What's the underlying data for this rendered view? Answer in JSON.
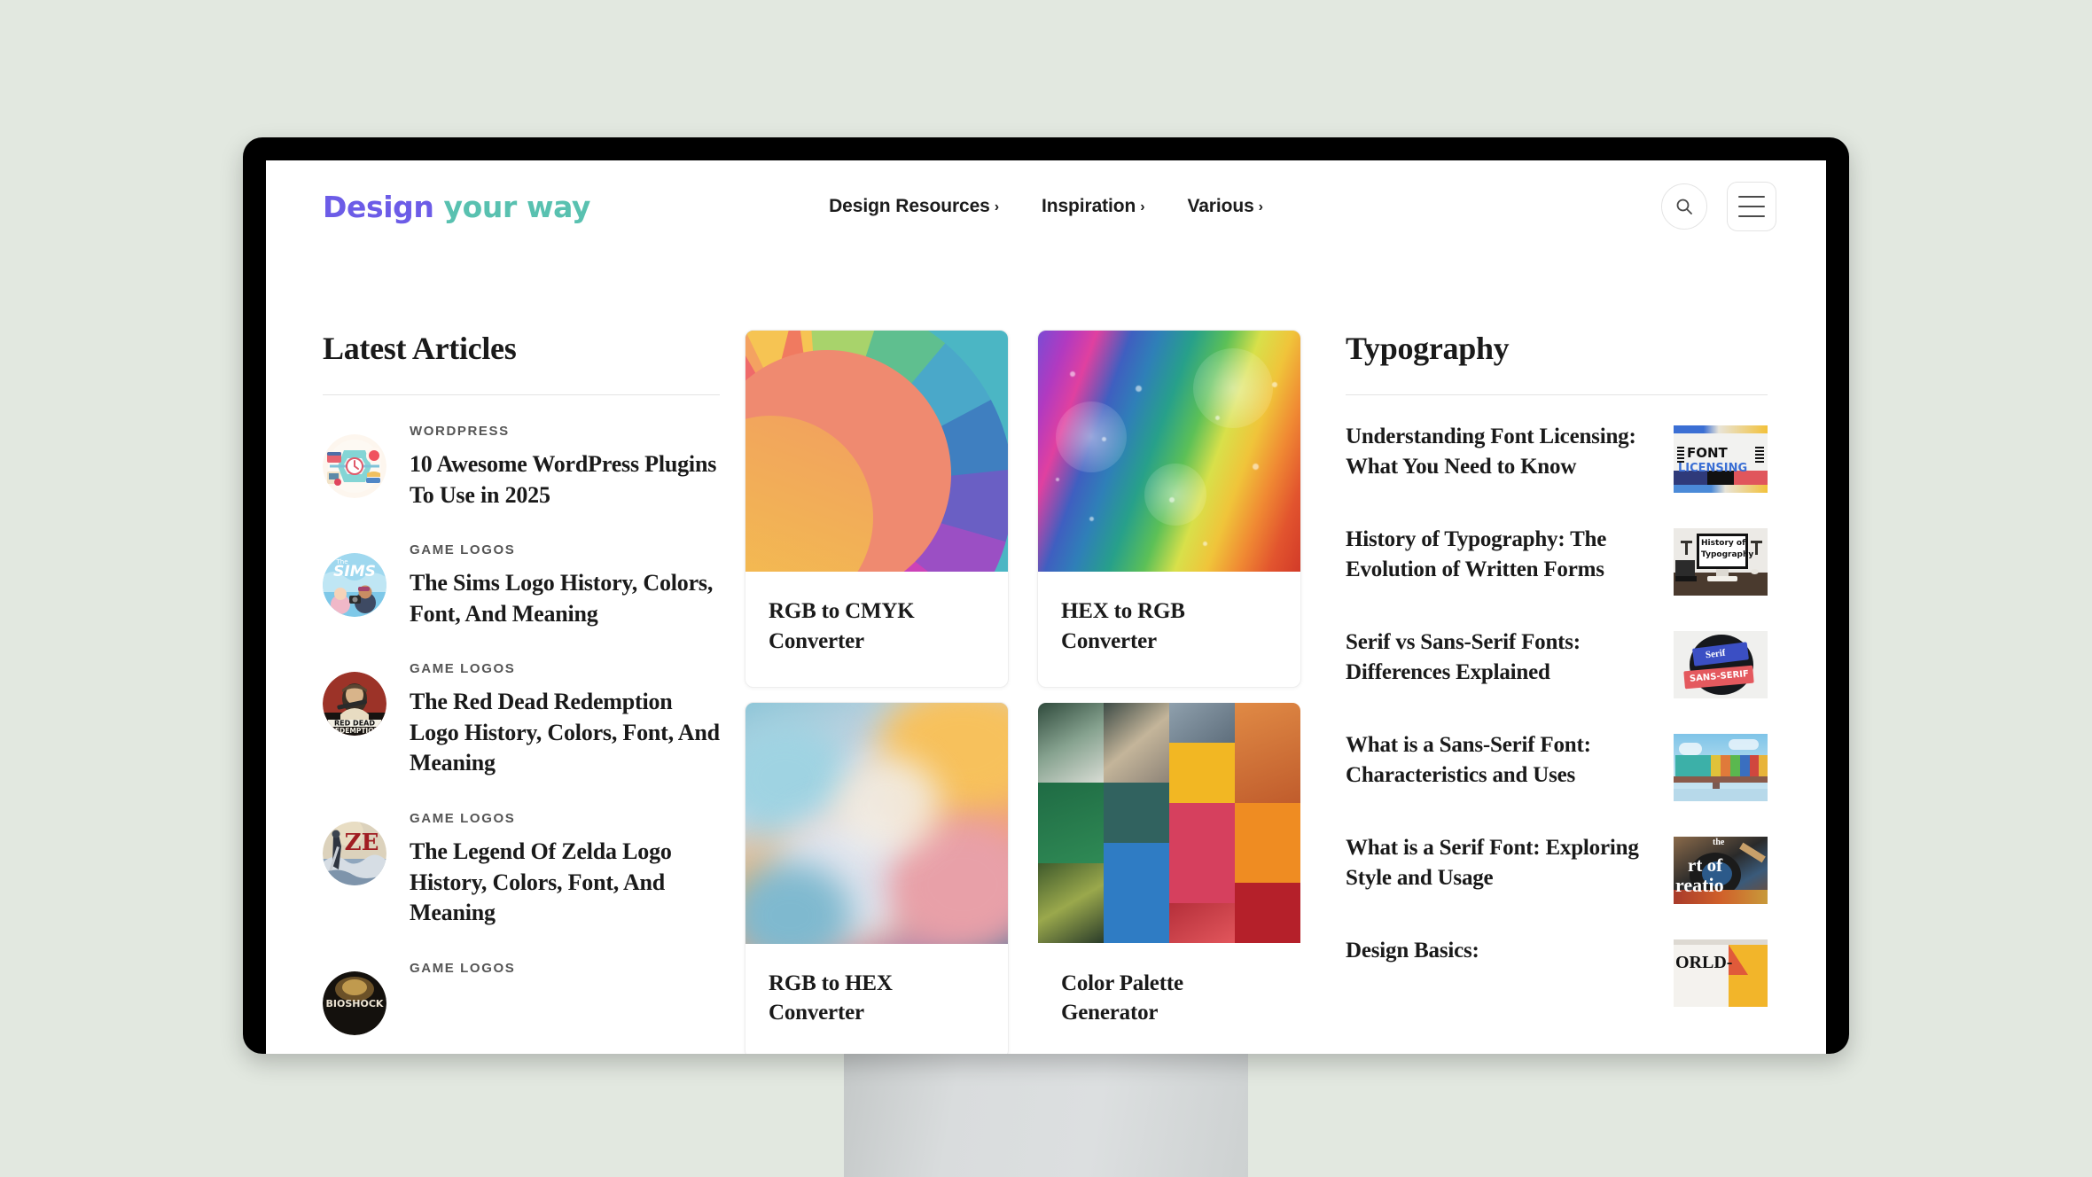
{
  "page": {
    "background_color": "#e2e8e0",
    "device": "desktop-monitor-mockup"
  },
  "header": {
    "logo": {
      "part_one": "Design",
      "part_two": "your way",
      "color_one": "#6c5ce7",
      "color_two": "#59c1b0"
    },
    "nav": [
      {
        "label": "Design Resources",
        "chevron": "›"
      },
      {
        "label": "Inspiration",
        "chevron": "›"
      },
      {
        "label": "Various",
        "chevron": "›"
      }
    ],
    "actions": {
      "search_icon": "search-icon",
      "menu_icon": "hamburger-menu-icon"
    }
  },
  "latest_articles": {
    "title": "Latest Articles",
    "items": [
      {
        "category": "WORDPRESS",
        "title": "10 Awesome WordPress Plugins To Use in 2025",
        "thumb": "wordpress-plugins-infographic"
      },
      {
        "category": "GAME LOGOS",
        "title": "The Sims Logo History, Colors, Font, And Meaning",
        "thumb": "the-sims-logo"
      },
      {
        "category": "GAME LOGOS",
        "title": "The Red Dead Redemption Logo History, Colors, Font, And Meaning",
        "thumb": "red-dead-redemption-logo"
      },
      {
        "category": "GAME LOGOS",
        "title": "The Legend Of Zelda Logo History, Colors, Font, And Meaning",
        "thumb": "zelda-logo"
      },
      {
        "category": "GAME LOGOS",
        "title": "",
        "thumb": "bioshock-logo"
      }
    ]
  },
  "tools": {
    "cards": [
      {
        "title": "RGB to CMYK Converter",
        "art": "color-fan-swatch"
      },
      {
        "title": "HEX to RGB Converter",
        "art": "rainbow-stripes"
      },
      {
        "title": "RGB to HEX Converter",
        "art": "colored-clouds"
      },
      {
        "title": "Color Palette Generator",
        "art": "color-mosaic-grid"
      }
    ]
  },
  "typography": {
    "title": "Typography",
    "items": [
      {
        "title": "Understanding Font Licensing: What You Need to Know",
        "thumb": "font-licensing-thumb",
        "thumb_text_1": "FONT",
        "thumb_text_2": "LICENSING"
      },
      {
        "title": "History of Typography: The Evolution of Written Forms",
        "thumb": "history-of-typography-thumb",
        "thumb_text_1": "History of",
        "thumb_text_2": "Typography"
      },
      {
        "title": "Serif vs Sans-Serif Fonts: Differences Explained",
        "thumb": "serif-vs-sans-serif-thumb",
        "thumb_text_1": "Serif",
        "thumb_text_2": "SANS-SERIF"
      },
      {
        "title": "What is a Sans-Serif Font: Characteristics and Uses",
        "thumb": "sans-serif-billboard-thumb",
        "thumb_text_1": "",
        "thumb_text_2": ""
      },
      {
        "title": "What is a Serif Font: Exploring Style and Usage",
        "thumb": "art-of-creation-thumb",
        "thumb_text_1": "the",
        "thumb_text_2": "rt of"
      },
      {
        "title": "Design Basics:",
        "thumb": "world-thumb",
        "thumb_text_1": "ORLD-",
        "thumb_text_2": ""
      }
    ]
  }
}
